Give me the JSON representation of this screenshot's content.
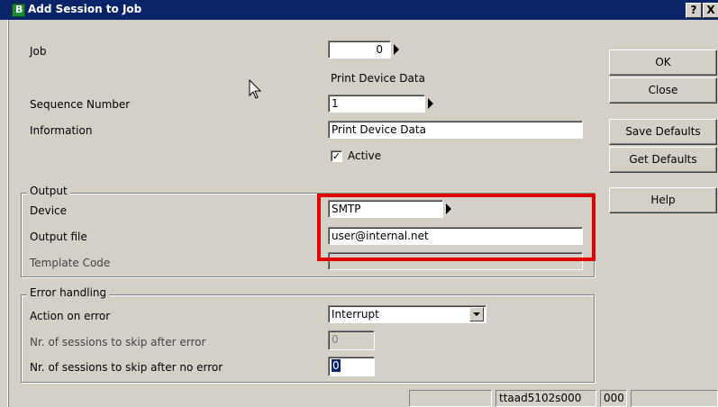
{
  "window": {
    "title": "Add Session to Job",
    "app_icon_letter": "B",
    "help_button": "?",
    "close_button": "X"
  },
  "form": {
    "job": {
      "label": "Job",
      "value": "0"
    },
    "job_description": "Print Device Data",
    "sequence_number": {
      "label": "Sequence Number",
      "value": "1"
    },
    "information": {
      "label": "Information",
      "value": "Print Device Data"
    },
    "active": {
      "label": "Active",
      "checked": true
    }
  },
  "output_group": {
    "legend": "Output",
    "device": {
      "label": "Device",
      "value": "SMTP"
    },
    "output_file": {
      "label": "Output file",
      "value": "user@internal.net"
    },
    "template_code": {
      "label": "Template Code",
      "value": ""
    }
  },
  "error_group": {
    "legend": "Error handling",
    "action_on_error": {
      "label": "Action on error",
      "value": "Interrupt"
    },
    "skip_after_error": {
      "label": "Nr. of sessions to skip after error",
      "value": "0"
    },
    "skip_after_no_error": {
      "label": "Nr. of sessions to skip after no error",
      "value": "0"
    }
  },
  "buttons": {
    "ok": "OK",
    "close": "Close",
    "save_defaults": "Save Defaults",
    "get_defaults": "Get Defaults",
    "help": "Help"
  },
  "status_bar": {
    "session": "ttaad5102s000",
    "code": "000"
  },
  "colors": {
    "title_bar": "#0a246a",
    "highlight": "#e00000",
    "window_background": "#d4d0c8"
  }
}
